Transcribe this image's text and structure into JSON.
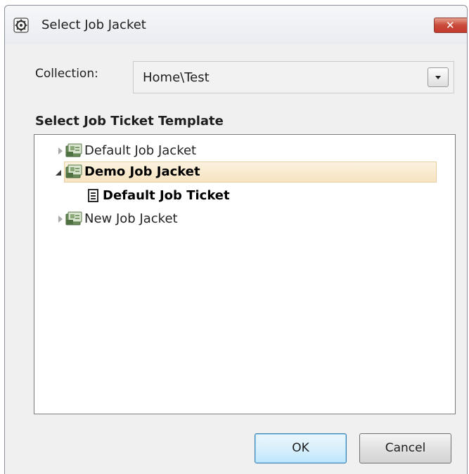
{
  "window": {
    "title": "Select Job Jacket",
    "app_icon": "gear-app-icon",
    "close_icon": "close-icon"
  },
  "collection": {
    "label": "Collection:",
    "value": "Home\\Test",
    "dropdown_icon": "chevron-down-icon"
  },
  "template_section": {
    "heading": "Select Job Ticket Template"
  },
  "tree": {
    "items": [
      {
        "label": "Default Job Jacket",
        "level": 0,
        "expanded": false,
        "selected": false,
        "icon": "job-jacket-icon"
      },
      {
        "label": "Demo Job Jacket",
        "level": 0,
        "expanded": true,
        "selected": true,
        "icon": "job-jacket-icon"
      },
      {
        "label": "Default Job Ticket",
        "level": 1,
        "expanded": false,
        "selected": false,
        "icon": "job-ticket-icon"
      },
      {
        "label": "New Job Jacket",
        "level": 0,
        "expanded": false,
        "selected": false,
        "icon": "job-jacket-icon"
      }
    ]
  },
  "buttons": {
    "ok_label": "OK",
    "cancel_label": "Cancel"
  },
  "colors": {
    "selection": "#f6e3c0",
    "close_button": "#c9493a",
    "default_button_border": "#3c7fb1"
  }
}
